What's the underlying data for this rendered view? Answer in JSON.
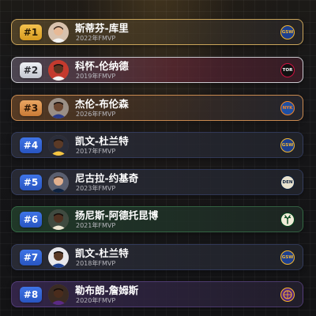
{
  "rankings": [
    {
      "rank": "#1",
      "name": "斯蒂芬-库里",
      "subtitle": "2022年FMVP",
      "team_logo": "GSW",
      "logo_icon": "warriors-logo-icon",
      "tier": "gold"
    },
    {
      "rank": "#2",
      "name": "科怀-伦纳德",
      "subtitle": "2019年FMVP",
      "team_logo": "TOR",
      "logo_icon": "raptors-logo-icon",
      "tier": "silver"
    },
    {
      "rank": "#3",
      "name": "杰伦-布伦森",
      "subtitle": "2026年FMVP",
      "team_logo": "NYK",
      "logo_icon": "knicks-logo-icon",
      "tier": "bronze"
    },
    {
      "rank": "#4",
      "name": "凯文-杜兰特",
      "subtitle": "2017年FMVP",
      "team_logo": "GSW",
      "logo_icon": "warriors-logo-icon",
      "tier": "blue"
    },
    {
      "rank": "#5",
      "name": "尼古拉-约基奇",
      "subtitle": "2023年FMVP",
      "team_logo": "DEN",
      "logo_icon": "nuggets-logo-icon",
      "tier": "blue"
    },
    {
      "rank": "#6",
      "name": "扬尼斯-阿德托昆博",
      "subtitle": "2021年FMVP",
      "team_logo": "",
      "logo_icon": "bucks-logo-icon",
      "tier": "green"
    },
    {
      "rank": "#7",
      "name": "凯文-杜兰特",
      "subtitle": "2018年FMVP",
      "team_logo": "GSW",
      "logo_icon": "warriors-logo-icon",
      "tier": "blue"
    },
    {
      "rank": "#8",
      "name": "勒布朗-詹姆斯",
      "subtitle": "2020年FMVP",
      "team_logo": "",
      "logo_icon": "lakers-logo-icon",
      "tier": "purple"
    }
  ],
  "colors": {
    "gold_badge": "#f3c24f",
    "silver_badge": "#e6e8ee",
    "bronze_badge": "#e19a58",
    "rank_badge_blue": "#3567d9",
    "background": "#141416"
  }
}
